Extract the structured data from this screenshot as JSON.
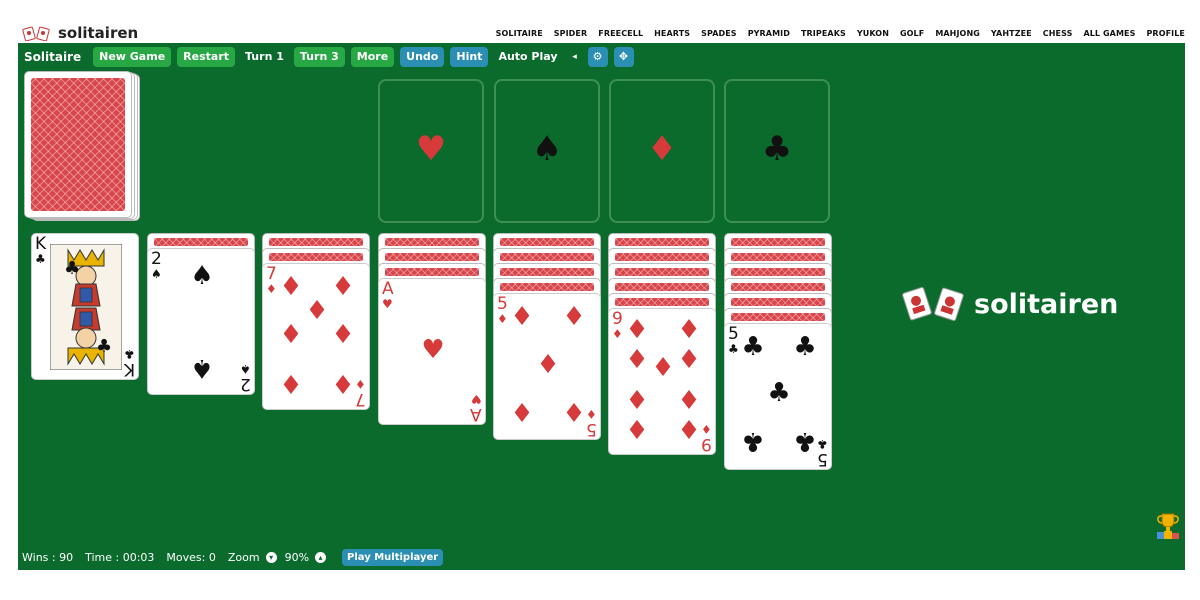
{
  "header": {
    "logo_text": "solitairen",
    "nav": [
      "SOLITAIRE",
      "SPIDER",
      "FREECELL",
      "HEARTS",
      "SPADES",
      "PYRAMID",
      "TRIPEAKS",
      "YUKON",
      "GOLF",
      "MAHJONG",
      "YAHTZEE",
      "CHESS",
      "ALL GAMES",
      "PROFILE"
    ]
  },
  "toolbar": {
    "title": "Solitaire",
    "new_game": "New Game",
    "restart": "Restart",
    "turn1": "Turn 1",
    "turn3": "Turn 3",
    "more": "More",
    "undo": "Undo",
    "hint": "Hint",
    "auto_play": "Auto Play",
    "sound_icon": "◂",
    "settings_icon": "⚙",
    "fullscreen_icon": "✥"
  },
  "foundations": [
    {
      "suit": "♥",
      "color": "#d63a3a"
    },
    {
      "suit": "♠",
      "color": "#111111"
    },
    {
      "suit": "♦",
      "color": "#d63a3a"
    },
    {
      "suit": "♣",
      "color": "#111111"
    }
  ],
  "tableau": [
    {
      "hidden": 0,
      "rank": "K",
      "suit": "♣",
      "color": "black"
    },
    {
      "hidden": 1,
      "rank": "2",
      "suit": "♠",
      "color": "black"
    },
    {
      "hidden": 2,
      "rank": "7",
      "suit": "♦",
      "color": "red"
    },
    {
      "hidden": 3,
      "rank": "A",
      "suit": "♥",
      "color": "red"
    },
    {
      "hidden": 4,
      "rank": "5",
      "suit": "♦",
      "color": "red"
    },
    {
      "hidden": 5,
      "rank": "9",
      "suit": "♦",
      "color": "red"
    },
    {
      "hidden": 6,
      "rank": "5",
      "suit": "♣",
      "color": "black"
    }
  ],
  "brand_text": "solitairen",
  "status": {
    "wins": "Wins : 90",
    "time": "Time : 00:03",
    "moves": "Moves: 0",
    "zoom_label": "Zoom",
    "zoom_value": "90%",
    "multiplayer": "Play Multiplayer"
  },
  "colors": {
    "table_green": "#0a6b2d",
    "button_green": "#28a745",
    "button_teal": "#2b8fb3",
    "card_red": "#d63a3a"
  }
}
